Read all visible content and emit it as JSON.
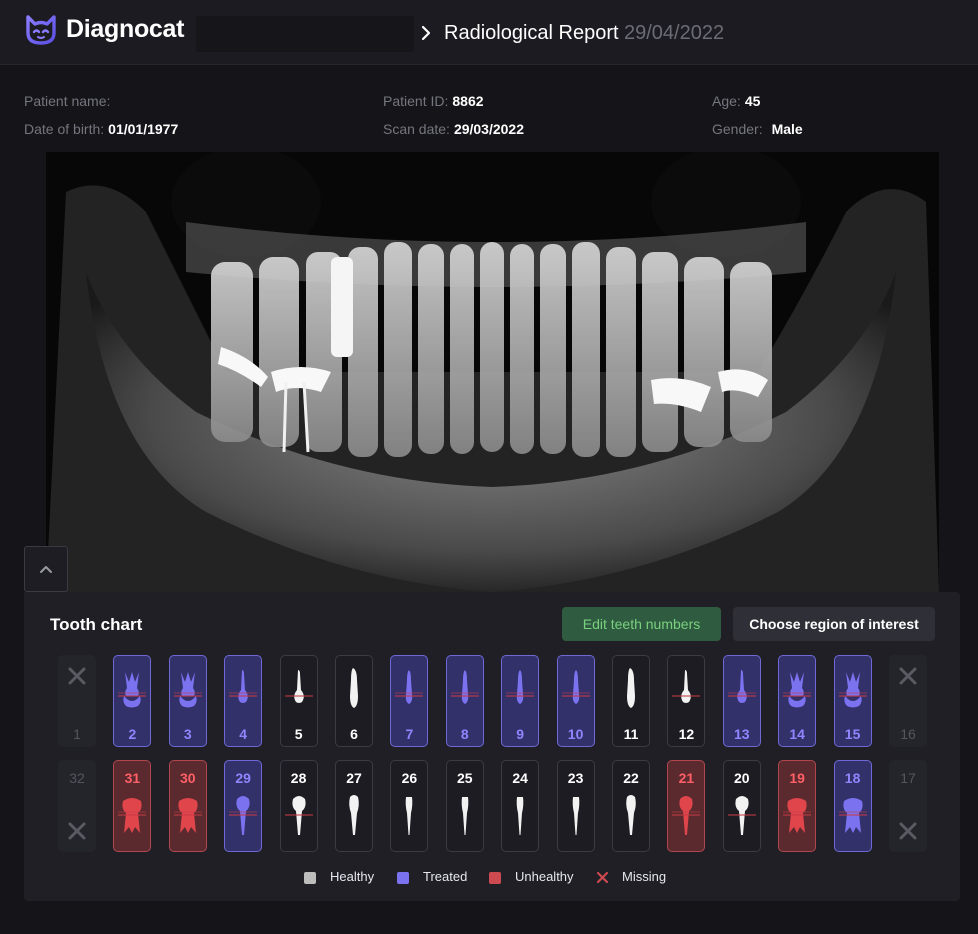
{
  "header": {
    "app_name": "Diagnocat",
    "breadcrumb_title": "Radiological Report",
    "report_date": "29/04/2022"
  },
  "patient": {
    "name_label": "Patient name:",
    "name_value": "",
    "dob_label": "Date of birth:",
    "dob_value": "01/01/1977",
    "id_label": "Patient ID:",
    "id_value": "8862",
    "scan_label": "Scan date:",
    "scan_value": "29/03/2022",
    "age_label": "Age:",
    "age_value": "45",
    "gender_label": "Gender:",
    "gender_value": "Male"
  },
  "tooth_chart": {
    "title": "Tooth chart",
    "edit_button": "Edit teeth numbers",
    "roi_button": "Choose region of interest",
    "upper": [
      {
        "n": "1",
        "status": "missing",
        "kind": "molar"
      },
      {
        "n": "2",
        "status": "treated",
        "kind": "molar"
      },
      {
        "n": "3",
        "status": "treated",
        "kind": "molar"
      },
      {
        "n": "4",
        "status": "treated",
        "kind": "premolar"
      },
      {
        "n": "5",
        "status": "healthy",
        "kind": "premolar"
      },
      {
        "n": "6",
        "status": "healthy",
        "kind": "canine"
      },
      {
        "n": "7",
        "status": "treated",
        "kind": "incisor"
      },
      {
        "n": "8",
        "status": "treated",
        "kind": "incisor"
      },
      {
        "n": "9",
        "status": "treated",
        "kind": "incisor"
      },
      {
        "n": "10",
        "status": "treated",
        "kind": "incisor"
      },
      {
        "n": "11",
        "status": "healthy",
        "kind": "canine"
      },
      {
        "n": "12",
        "status": "healthy",
        "kind": "premolar"
      },
      {
        "n": "13",
        "status": "treated",
        "kind": "premolar"
      },
      {
        "n": "14",
        "status": "treated",
        "kind": "molar"
      },
      {
        "n": "15",
        "status": "treated",
        "kind": "molar"
      },
      {
        "n": "16",
        "status": "missing",
        "kind": "molar"
      }
    ],
    "lower": [
      {
        "n": "32",
        "status": "missing",
        "kind": "molar"
      },
      {
        "n": "31",
        "status": "unhealthy",
        "kind": "molar"
      },
      {
        "n": "30",
        "status": "unhealthy",
        "kind": "molar"
      },
      {
        "n": "29",
        "status": "treated",
        "kind": "premolar"
      },
      {
        "n": "28",
        "status": "healthy",
        "kind": "premolar"
      },
      {
        "n": "27",
        "status": "healthy",
        "kind": "canine"
      },
      {
        "n": "26",
        "status": "healthy",
        "kind": "incisor"
      },
      {
        "n": "25",
        "status": "healthy",
        "kind": "incisor"
      },
      {
        "n": "24",
        "status": "healthy",
        "kind": "incisor"
      },
      {
        "n": "23",
        "status": "healthy",
        "kind": "incisor"
      },
      {
        "n": "22",
        "status": "healthy",
        "kind": "canine"
      },
      {
        "n": "21",
        "status": "unhealthy",
        "kind": "premolar"
      },
      {
        "n": "20",
        "status": "healthy",
        "kind": "premolar"
      },
      {
        "n": "19",
        "status": "unhealthy",
        "kind": "molar"
      },
      {
        "n": "18",
        "status": "treated",
        "kind": "molar"
      },
      {
        "n": "17",
        "status": "missing",
        "kind": "molar"
      }
    ],
    "legend": {
      "healthy": "Healthy",
      "treated": "Treated",
      "unhealthy": "Unhealthy",
      "missing": "Missing"
    },
    "colors": {
      "healthy": "#bdbdbd",
      "treated": "#7b72f0",
      "unhealthy": "#cc4a50",
      "missing": "#cc4a50"
    }
  },
  "icons": {
    "logo": "diagnocat-cat-logo-icon",
    "breadcrumb": "chevron-right-icon",
    "collapse": "chevron-up-icon",
    "missing": "x-mark-icon"
  }
}
